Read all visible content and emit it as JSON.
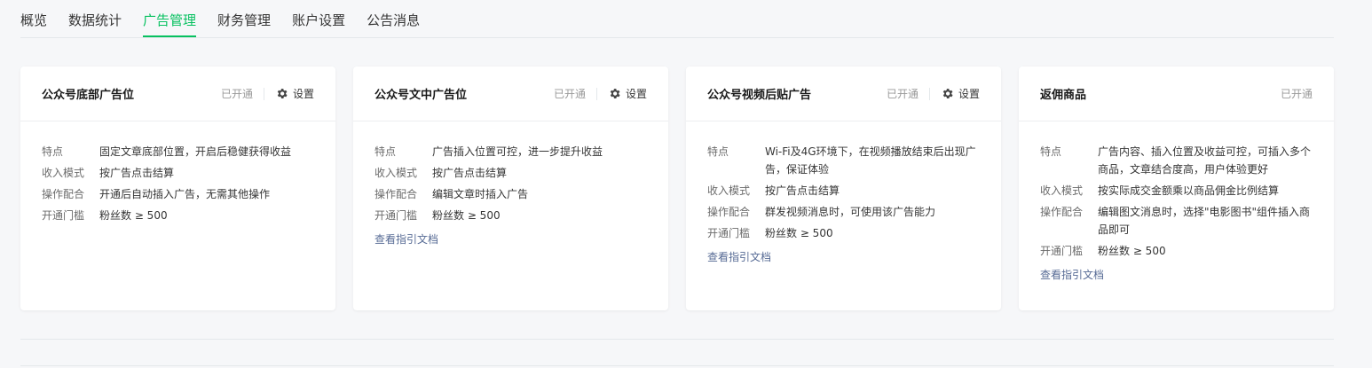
{
  "tabs": [
    {
      "label": "概览"
    },
    {
      "label": "数据统计"
    },
    {
      "label": "广告管理"
    },
    {
      "label": "财务管理"
    },
    {
      "label": "账户设置"
    },
    {
      "label": "公告消息"
    }
  ],
  "accent_color": "#07c160",
  "link_color": "#576b95",
  "cards": [
    {
      "title": "公众号底部广告位",
      "status": "已开通",
      "setting_label": "设置",
      "rows": [
        {
          "k": "特点",
          "v": "固定文章底部位置，开启后稳健获得收益"
        },
        {
          "k": "收入模式",
          "v": "按广告点击结算"
        },
        {
          "k": "操作配合",
          "v": "开通后自动插入广告，无需其他操作"
        },
        {
          "k": "开通门槛",
          "v": "粉丝数 ≥ 500"
        }
      ]
    },
    {
      "title": "公众号文中广告位",
      "status": "已开通",
      "setting_label": "设置",
      "rows": [
        {
          "k": "特点",
          "v": "广告插入位置可控，进一步提升收益"
        },
        {
          "k": "收入模式",
          "v": "按广告点击结算"
        },
        {
          "k": "操作配合",
          "v": "编辑文章时插入广告"
        },
        {
          "k": "开通门槛",
          "v": "粉丝数 ≥ 500"
        }
      ],
      "link": "查看指引文档"
    },
    {
      "title": "公众号视频后贴广告",
      "status": "已开通",
      "setting_label": "设置",
      "rows": [
        {
          "k": "特点",
          "v": "Wi-Fi及4G环境下，在视频播放结束后出现广告，保证体验"
        },
        {
          "k": "收入模式",
          "v": "按广告点击结算"
        },
        {
          "k": "操作配合",
          "v": "群发视频消息时，可使用该广告能力"
        },
        {
          "k": "开通门槛",
          "v": "粉丝数 ≥ 500"
        }
      ],
      "link": "查看指引文档"
    },
    {
      "title": "返佣商品",
      "status": "已开通",
      "rows": [
        {
          "k": "特点",
          "v": "广告内容、插入位置及收益可控，可插入多个商品，文章结合度高，用户体验更好"
        },
        {
          "k": "收入模式",
          "v": "按实际成交金额乘以商品佣金比例结算"
        },
        {
          "k": "操作配合",
          "v": "编辑图文消息时，选择\"电影图书\"组件插入商品即可"
        },
        {
          "k": "开通门槛",
          "v": "粉丝数 ≥ 500"
        }
      ],
      "link": "查看指引文档"
    }
  ]
}
